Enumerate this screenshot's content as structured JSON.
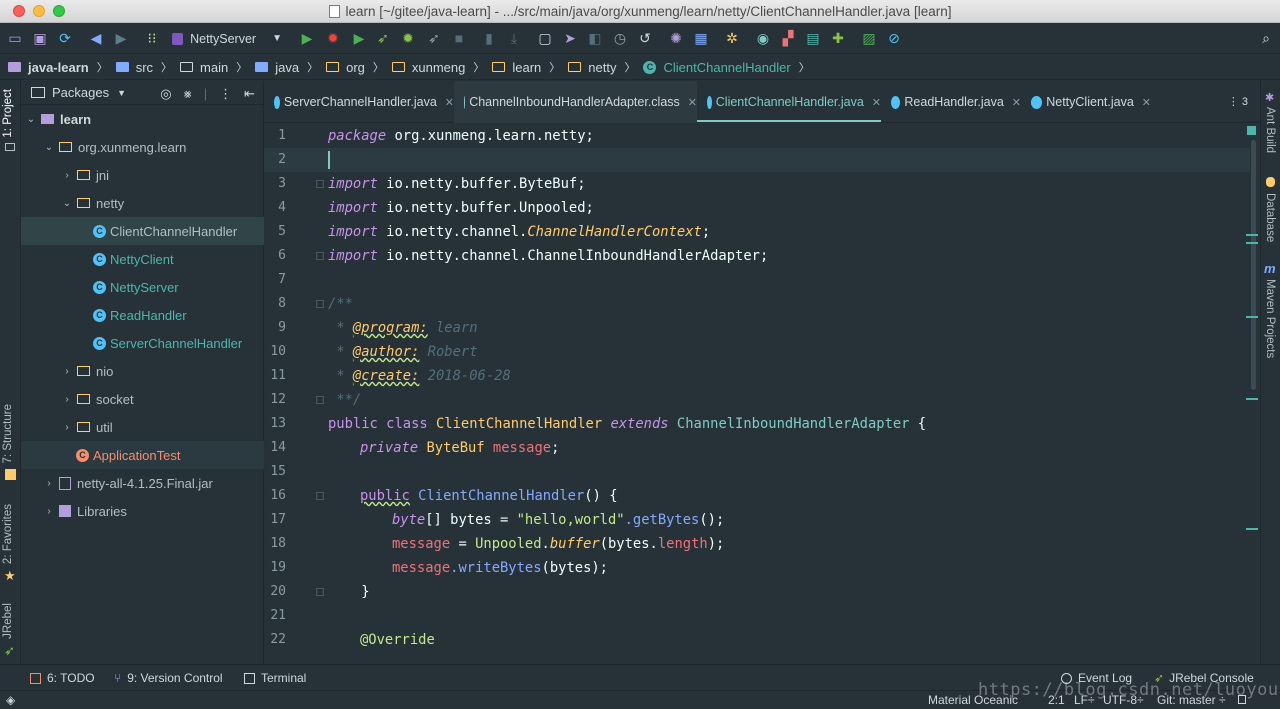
{
  "window": {
    "title": "learn [~/gitee/java-learn] - .../src/main/java/org/xunmeng/learn/netty/ClientChannelHandler.java [learn]"
  },
  "toolbar": {
    "run_config": "NettyServer"
  },
  "breadcrumb": [
    "java-learn",
    "src",
    "main",
    "java",
    "org",
    "xunmeng",
    "learn",
    "netty",
    "ClientChannelHandler"
  ],
  "left_tools": {
    "project": "1: Project",
    "structure": "7: Structure",
    "favorites": "2: Favorites",
    "jrebel": "JRebel"
  },
  "right_tools": {
    "ant_build": "Ant Build",
    "database": "Database",
    "maven": "Maven Projects"
  },
  "panel": {
    "view_name": "Packages",
    "tree": [
      {
        "label": "learn"
      },
      {
        "label": "org.xunmeng.learn"
      },
      {
        "label": "jni"
      },
      {
        "label": "netty"
      },
      {
        "label": "ClientChannelHandler"
      },
      {
        "label": "NettyClient"
      },
      {
        "label": "NettyServer"
      },
      {
        "label": "ReadHandler"
      },
      {
        "label": "ServerChannelHandler"
      },
      {
        "label": "nio"
      },
      {
        "label": "socket"
      },
      {
        "label": "util"
      },
      {
        "label": "ApplicationTest"
      },
      {
        "label": "netty-all-4.1.25.Final.jar"
      },
      {
        "label": "Libraries"
      }
    ]
  },
  "tabs": [
    {
      "label": "ServerChannelHandler.java"
    },
    {
      "label": "ChannelInboundHandlerAdapter.class"
    },
    {
      "label": "ClientChannelHandler.java"
    },
    {
      "label": "ReadHandler.java"
    },
    {
      "label": "NettyClient.java"
    }
  ],
  "tabs_overflow": "3",
  "editor": {
    "line_numbers": [
      "1",
      "2",
      "3",
      "4",
      "5",
      "6",
      "7",
      "8",
      "9",
      "10",
      "11",
      "12",
      "13",
      "14",
      "15",
      "16",
      "17",
      "18",
      "19",
      "20",
      "21",
      "22"
    ],
    "code": {
      "l1_kw": "package",
      "l1_rest": " org.xunmeng.learn.netty;",
      "import_kw": "import",
      "l3_rest": " io.netty.buffer.ByteBuf;",
      "l4_rest": " io.netty.buffer.Unpooled;",
      "l5_pre": " io.netty.channel.",
      "l5_cls": "ChannelHandlerContext",
      "l5_end": ";",
      "l6_rest": " io.netty.channel.ChannelInboundHandlerAdapter;",
      "l8": "/**",
      "star": " * ",
      "tag_program": "@program:",
      "val_program": " learn",
      "tag_author": "@author:",
      "val_author": " Robert",
      "tag_create": "@create:",
      "val_create": " 2018-06-28",
      "l12": " **/",
      "l13_public": "public",
      "l13_class": " class ",
      "l13_name": "ClientChannelHandler",
      "l13_extends": " extends ",
      "l13_super": "ChannelInboundHandlerAdapter",
      "l13_brace": " {",
      "l14_private": "private",
      "l14_type": " ByteBuf ",
      "l14_field": "message",
      "l14_end": ";",
      "l16_public": "public",
      "l16_name": " ClientChannelHandler",
      "l16_rest": "() {",
      "l17_type": "byte",
      "l17_rest1": "[] bytes = ",
      "l17_str": "\"hello,world\"",
      "l17_call": ".getBytes",
      "l17_end": "();",
      "l18_field": "message",
      "l18_eq": " = ",
      "l18_cls": "Unpooled",
      "l18_dot": ".",
      "l18_fn": "buffer",
      "l18_args": "(bytes.",
      "l18_len": "length",
      "l18_end": ");",
      "l19_field": "message",
      "l19_call": ".writeBytes",
      "l19_end": "(bytes);",
      "l20": "    }",
      "l22": "@Override"
    }
  },
  "bottom_tools": {
    "todo": "6: TODO",
    "vcs": "9: Version Control",
    "terminal": "Terminal",
    "event_log": "Event Log",
    "jrebel_console": "JRebel Console"
  },
  "status": {
    "theme": "Material Oceanic",
    "position": "2:1",
    "line_sep": "LF÷",
    "encoding": "UTF-8÷",
    "git": "Git: master ÷"
  },
  "watermark": "https://blog.csdn.net/luoyoub",
  "colors": {
    "background": "#263238",
    "accent": "#80cbc4",
    "keyword": "#c792ea",
    "class": "#ffcb6b",
    "string": "#c3e88d",
    "field": "#f07178"
  }
}
